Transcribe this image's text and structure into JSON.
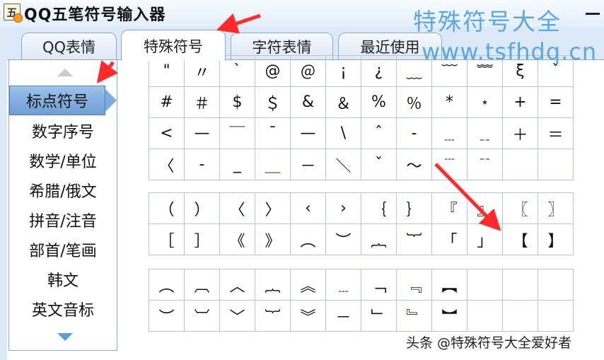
{
  "window": {
    "app_icon_glyph": "五",
    "title": "QQ五笔符号输入器",
    "minimize_glyph": "–"
  },
  "tabs": [
    {
      "label": "QQ表情"
    },
    {
      "label": "特殊符号"
    },
    {
      "label": "字符表情"
    },
    {
      "label": "最近使用"
    }
  ],
  "categories": [
    {
      "label": "标点符号"
    },
    {
      "label": "数字序号"
    },
    {
      "label": "数学/单位"
    },
    {
      "label": "希腊/俄文"
    },
    {
      "label": "拼音/注音"
    },
    {
      "label": "部首/笔画"
    },
    {
      "label": "韩文"
    },
    {
      "label": "英文音标"
    }
  ],
  "symbols_group1": [
    "\"",
    "〃",
    "`",
    "@",
    "＠",
    "¡",
    "¿",
    "﹏",
    "﹋",
    "﹌",
    "ξ",
    "ˇ",
    "#",
    "＃",
    "$",
    "＄",
    "&",
    "＆",
    "%",
    "％",
    "*",
    "﹡",
    "+",
    "=",
    "<",
    "—",
    "￣",
    "ˉ",
    "—",
    "\\",
    "ˆ",
    "-",
    "﹍",
    "﹎",
    "＋",
    "＝",
    "〈",
    "-",
    "_",
    "＿",
    "－",
    "＼",
    "ˇ",
    "～",
    "﹉",
    "﹊",
    "",
    ""
  ],
  "symbols_group2": [
    "（",
    "）",
    "〈",
    "〉",
    "‹",
    "›",
    "｛",
    "｝",
    "『",
    "』",
    "〖",
    "〗",
    "［",
    "］",
    "《",
    "》",
    "︵",
    "︶",
    "︷",
    "︸",
    "「",
    "」",
    "【",
    "】"
  ],
  "symbols_group3": [
    "︵",
    "︹",
    "︿",
    "︷",
    "︽",
    "﹍",
    "﹁",
    "﹃",
    "︻",
    "",
    "",
    "",
    "︶",
    "︺",
    "﹀",
    "︸",
    "︾",
    "－",
    "﹂",
    "﹄",
    "︼",
    "",
    "",
    ""
  ],
  "watermarks": {
    "top_title": "特殊符号大全",
    "url": "www.tsfhdq.cn",
    "bottom": "头条 @特殊符号大全爱好者"
  },
  "colors": {
    "window_bg": "#dce9f8",
    "accent_blue": "#5aa6e6",
    "active_category": "#7ea9da",
    "annotation_red": "#ff2a2a"
  }
}
